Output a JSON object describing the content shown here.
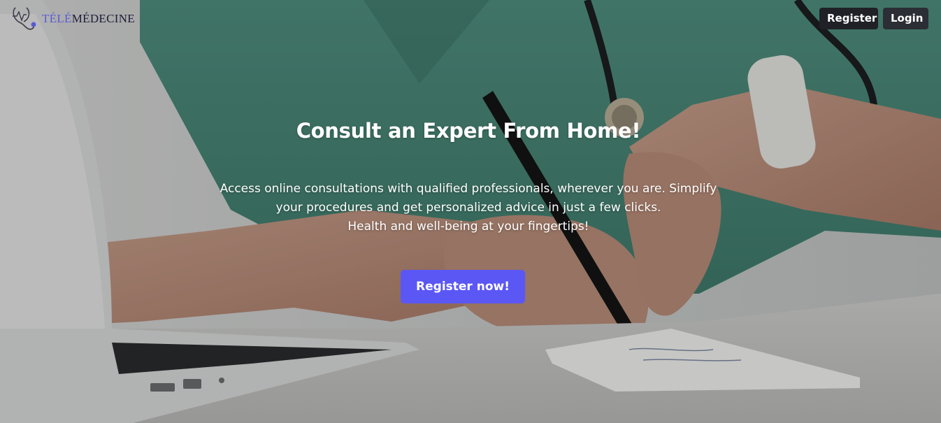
{
  "brand": {
    "logo_accent": "TÉLÉ",
    "logo_rest": "MÉDECINE",
    "icon": "stethoscope-icon",
    "accent_color": "#5b5bd6"
  },
  "nav": {
    "register_label": "Register",
    "login_label": "Login"
  },
  "hero": {
    "headline": "Consult an Expert From Home!",
    "sub_line1": "Access online consultations with qualified professionals, wherever you are. Simplify",
    "sub_line2": "your procedures and get personalized advice in just a few clicks.",
    "sub_line3": "Health and well-being at your fingertips!",
    "cta_label": "Register now!",
    "cta_color": "#5b57f5",
    "background_image": "doctor-writing-at-desk-photo"
  }
}
